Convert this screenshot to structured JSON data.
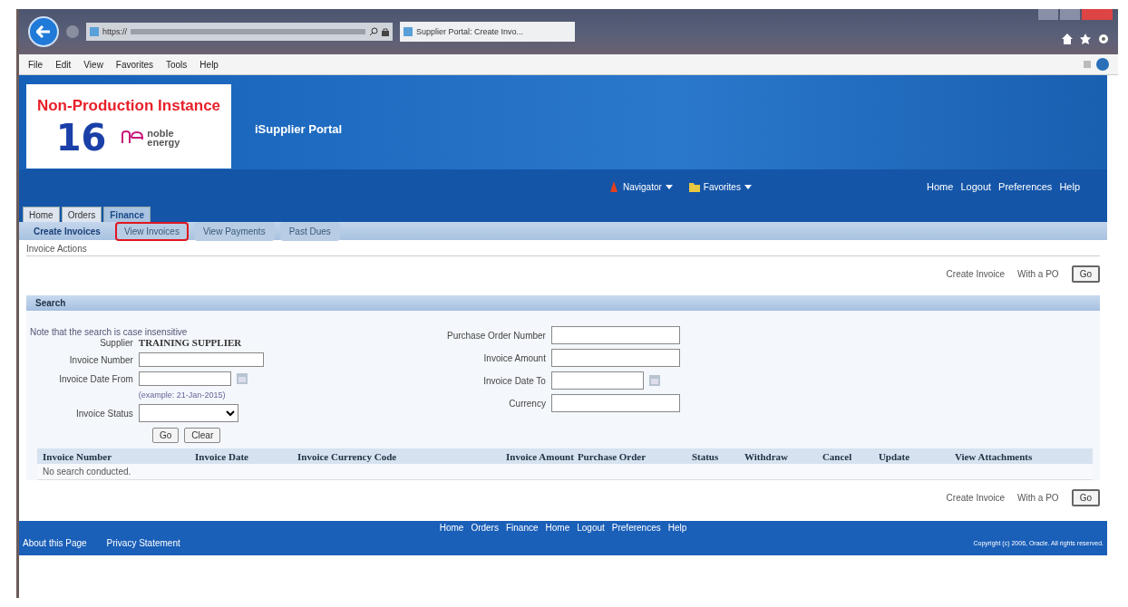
{
  "browser": {
    "address": "https://",
    "tab_title": "Supplier Portal: Create Invo...",
    "menu": [
      "File",
      "Edit",
      "View",
      "Favorites",
      "Tools",
      "Help"
    ]
  },
  "header": {
    "instance_label": "Non-Production Instance",
    "instance_number": "16",
    "company": "noble energy",
    "app_title": "iSupplier Portal",
    "menus": [
      "Navigator",
      "Favorites"
    ],
    "global_links": [
      "Home",
      "Logout",
      "Preferences",
      "Help"
    ]
  },
  "tabs": [
    {
      "label": "Home",
      "selected": false
    },
    {
      "label": "Orders",
      "selected": false
    },
    {
      "label": "Finance",
      "selected": true
    }
  ],
  "subtabs": [
    {
      "label": "Create Invoices",
      "selected": true,
      "highlighted": false
    },
    {
      "label": "View Invoices",
      "selected": false,
      "highlighted": true
    },
    {
      "label": "View Payments",
      "selected": false,
      "highlighted": false
    },
    {
      "label": "Past Dues",
      "selected": false,
      "highlighted": false
    }
  ],
  "section_title": "Invoice Actions",
  "create_actions": [
    {
      "label": "Create Invoice",
      "option": "With a PO",
      "button": "Go"
    },
    {
      "label": "Create Invoice",
      "option": "With a PO",
      "button": "Go"
    }
  ],
  "search": {
    "title": "Search",
    "note": "Note that the search is case insensitive",
    "supplier_label": "Supplier",
    "supplier": "TRAINING SUPPLIER",
    "left_fields": [
      {
        "label": "Invoice Number",
        "kind": "text"
      },
      {
        "label": "Invoice Date From",
        "kind": "date",
        "hint": "(example: 21-Jan-2015)"
      },
      {
        "label": "Invoice Status",
        "kind": "select"
      }
    ],
    "right_fields": [
      {
        "label": "Purchase Order Number",
        "kind": "text"
      },
      {
        "label": "Invoice Amount",
        "kind": "text"
      },
      {
        "label": "Invoice Date To",
        "kind": "date"
      },
      {
        "label": "Currency",
        "kind": "text"
      }
    ],
    "buttons": [
      "Go",
      "Clear"
    ]
  },
  "table": {
    "columns": [
      "Invoice Number",
      "Invoice Date",
      "Invoice Currency Code",
      "Invoice Amount",
      "Purchase Order",
      "Status",
      "Withdraw",
      "Cancel",
      "Update",
      "View Attachments"
    ],
    "empty_text": "No search conducted."
  },
  "footer": {
    "links": [
      "Home",
      "Orders",
      "Finance",
      "Home",
      "Logout",
      "Preferences",
      "Help"
    ],
    "about": "About this Page",
    "privacy": "Privacy Statement",
    "copyright": "Copyright (c) 2006, Oracle. All rights reserved."
  }
}
